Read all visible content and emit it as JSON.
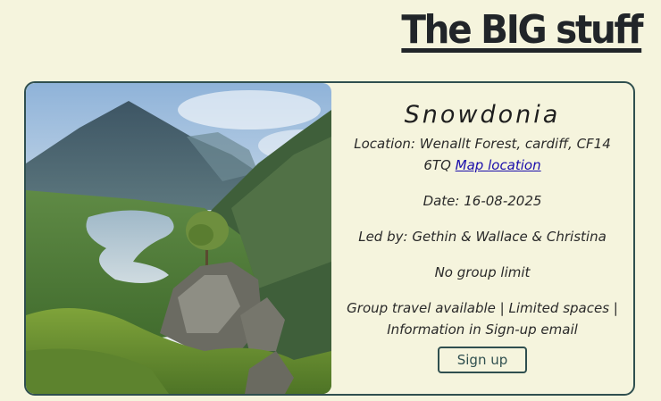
{
  "header": {
    "title": "The BIG stuff"
  },
  "event": {
    "title": "Snowdonia",
    "image_alt": "Mountain lake valley in Snowdonia",
    "location_text": "Location: Wenallt Forest, cardiff, CF14 6TQ",
    "map_link_label": "Map location",
    "date_text": "Date: 16-08-2025",
    "leaders_text": "Led by: Gethin & Wallace & Christina",
    "group_limit_text": "No group limit",
    "notes_text": "Group travel available | Limited spaces | Information in Sign-up email",
    "signup_label": "Sign up"
  },
  "colors": {
    "background": "#f5f4dd",
    "card_border": "#2f4f4f",
    "link": "#1a0dab",
    "title": "#212529"
  }
}
